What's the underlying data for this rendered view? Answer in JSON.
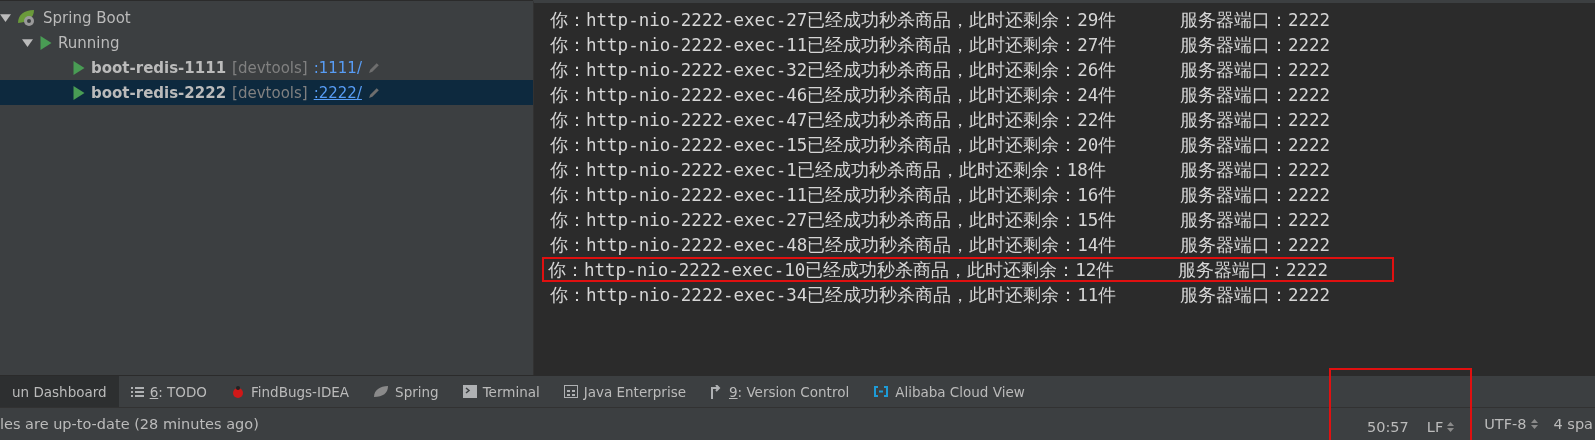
{
  "run_tree": {
    "root": {
      "label": "Spring Boot",
      "expanded": true,
      "children": [
        {
          "label": "Running",
          "expanded": true,
          "children": [
            {
              "name": "boot-redis-1111",
              "tag": "[devtools]",
              "port_link": ":1111/",
              "selected": false
            },
            {
              "name": "boot-redis-2222",
              "tag": "[devtools]",
              "port_link": ":2222/",
              "selected": true
            }
          ]
        }
      ]
    }
  },
  "console": {
    "lines": [
      {
        "text": "你：http-nio-2222-exec-27已经成功秒杀商品，此时还剩余：29件\t服务器端口：2222",
        "highlighted": false
      },
      {
        "text": "你：http-nio-2222-exec-11已经成功秒杀商品，此时还剩余：27件\t服务器端口：2222",
        "highlighted": false
      },
      {
        "text": "你：http-nio-2222-exec-32已经成功秒杀商品，此时还剩余：26件\t服务器端口：2222",
        "highlighted": false
      },
      {
        "text": "你：http-nio-2222-exec-46已经成功秒杀商品，此时还剩余：24件\t服务器端口：2222",
        "highlighted": false
      },
      {
        "text": "你：http-nio-2222-exec-47已经成功秒杀商品，此时还剩余：22件\t服务器端口：2222",
        "highlighted": false
      },
      {
        "text": "你：http-nio-2222-exec-15已经成功秒杀商品，此时还剩余：20件\t服务器端口：2222",
        "highlighted": false
      },
      {
        "text": "你：http-nio-2222-exec-1已经成功秒杀商品，此时还剩余：18件\t服务器端口：2222",
        "highlighted": false
      },
      {
        "text": "你：http-nio-2222-exec-11已经成功秒杀商品，此时还剩余：16件\t服务器端口：2222",
        "highlighted": false
      },
      {
        "text": "你：http-nio-2222-exec-27已经成功秒杀商品，此时还剩余：15件\t服务器端口：2222",
        "highlighted": false
      },
      {
        "text": "你：http-nio-2222-exec-48已经成功秒杀商品，此时还剩余：14件\t服务器端口：2222",
        "highlighted": false
      },
      {
        "text": "你：http-nio-2222-exec-10已经成功秒杀商品，此时还剩余：12件\t服务器端口：2222",
        "highlighted": true
      },
      {
        "text": "你：http-nio-2222-exec-34已经成功秒杀商品，此时还剩余：11件\t服务器端口：2222",
        "highlighted": false
      }
    ]
  },
  "tool_tabs": [
    {
      "kind": "dashboard",
      "label": "un Dashboard",
      "selected": true
    },
    {
      "kind": "todo",
      "mnemonic": "6",
      "label": ": TODO",
      "selected": false
    },
    {
      "kind": "findbugs",
      "label": "FindBugs-IDEA",
      "selected": false
    },
    {
      "kind": "spring",
      "label": "Spring",
      "selected": false
    },
    {
      "kind": "terminal",
      "label": "Terminal",
      "selected": false
    },
    {
      "kind": "enterprise",
      "label": "Java Enterprise",
      "selected": false
    },
    {
      "kind": "vcs",
      "mnemonic": "9",
      "label": ": Version Control",
      "selected": false
    },
    {
      "kind": "cloud",
      "label": "Alibaba Cloud View",
      "selected": false
    }
  ],
  "status_bar": {
    "message": "les are up-to-date (28 minutes ago)",
    "items": [
      {
        "text": "50:57",
        "boxed": true,
        "dropdown": false
      },
      {
        "text": "LF",
        "boxed": true,
        "dropdown": true
      },
      {
        "text": "UTF-8",
        "boxed": false,
        "dropdown": true
      },
      {
        "text": "4 spa",
        "boxed": false,
        "dropdown": false
      }
    ]
  }
}
